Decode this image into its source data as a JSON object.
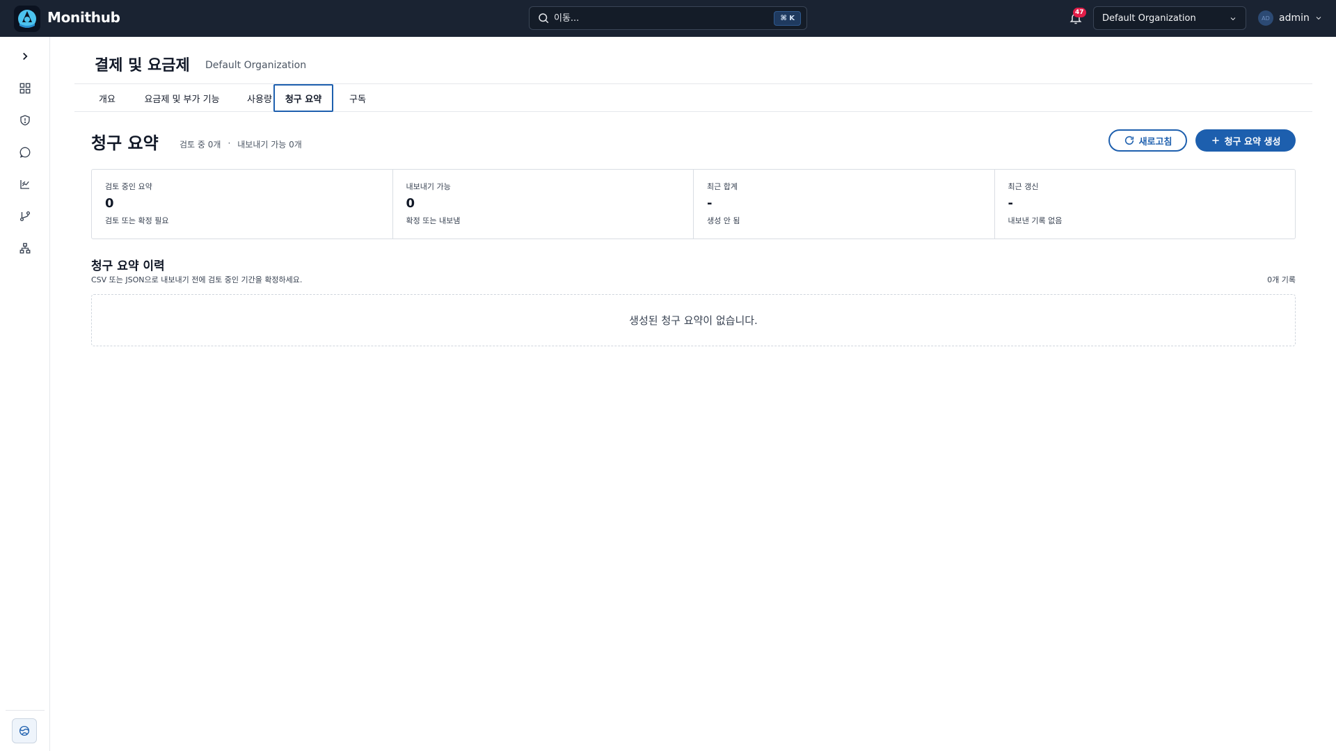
{
  "app": {
    "brand": "Monithub",
    "search_placeholder": "이동...",
    "search_shortcut": "⌘ K",
    "notification_count": "47",
    "organization": "Default Organization",
    "user_initials": "AD",
    "user_name": "admin"
  },
  "page": {
    "title": "결제 및 요금제",
    "subtitle": "Default Organization"
  },
  "tabs": [
    {
      "label": "개요"
    },
    {
      "label": "요금제 및 부가 기능"
    },
    {
      "label": "사용량"
    },
    {
      "label": "청구 요약",
      "active": true
    },
    {
      "label": "구독"
    }
  ],
  "section": {
    "title": "청구 요약",
    "meta_reviewing": "검토 중 0개",
    "meta_separator": "·",
    "meta_exportable": "내보내기 가능 0개",
    "refresh_label": "새로고침",
    "create_label": "청구 요약 생성"
  },
  "stats": [
    {
      "label": "검토 중인 요약",
      "value": "0",
      "desc": "검토 또는 확정 필요"
    },
    {
      "label": "내보내기 가능",
      "value": "0",
      "desc": "확정 또는 내보냄"
    },
    {
      "label": "최근 합계",
      "value": "-",
      "desc": "생성 안 됨"
    },
    {
      "label": "최근 갱신",
      "value": "-",
      "desc": "내보낸 기록 없음"
    }
  ],
  "history": {
    "title": "청구 요약 이력",
    "subtitle": "CSV 또는 JSON으로 내보내기 전에 검토 중인 기간을 확정하세요.",
    "count": "0개 기록",
    "empty_message": "생성된 청구 요약이 없습니다."
  },
  "colors": {
    "topbar": "#1a2332",
    "accent": "#1d5fae",
    "badge": "#e11d48"
  }
}
